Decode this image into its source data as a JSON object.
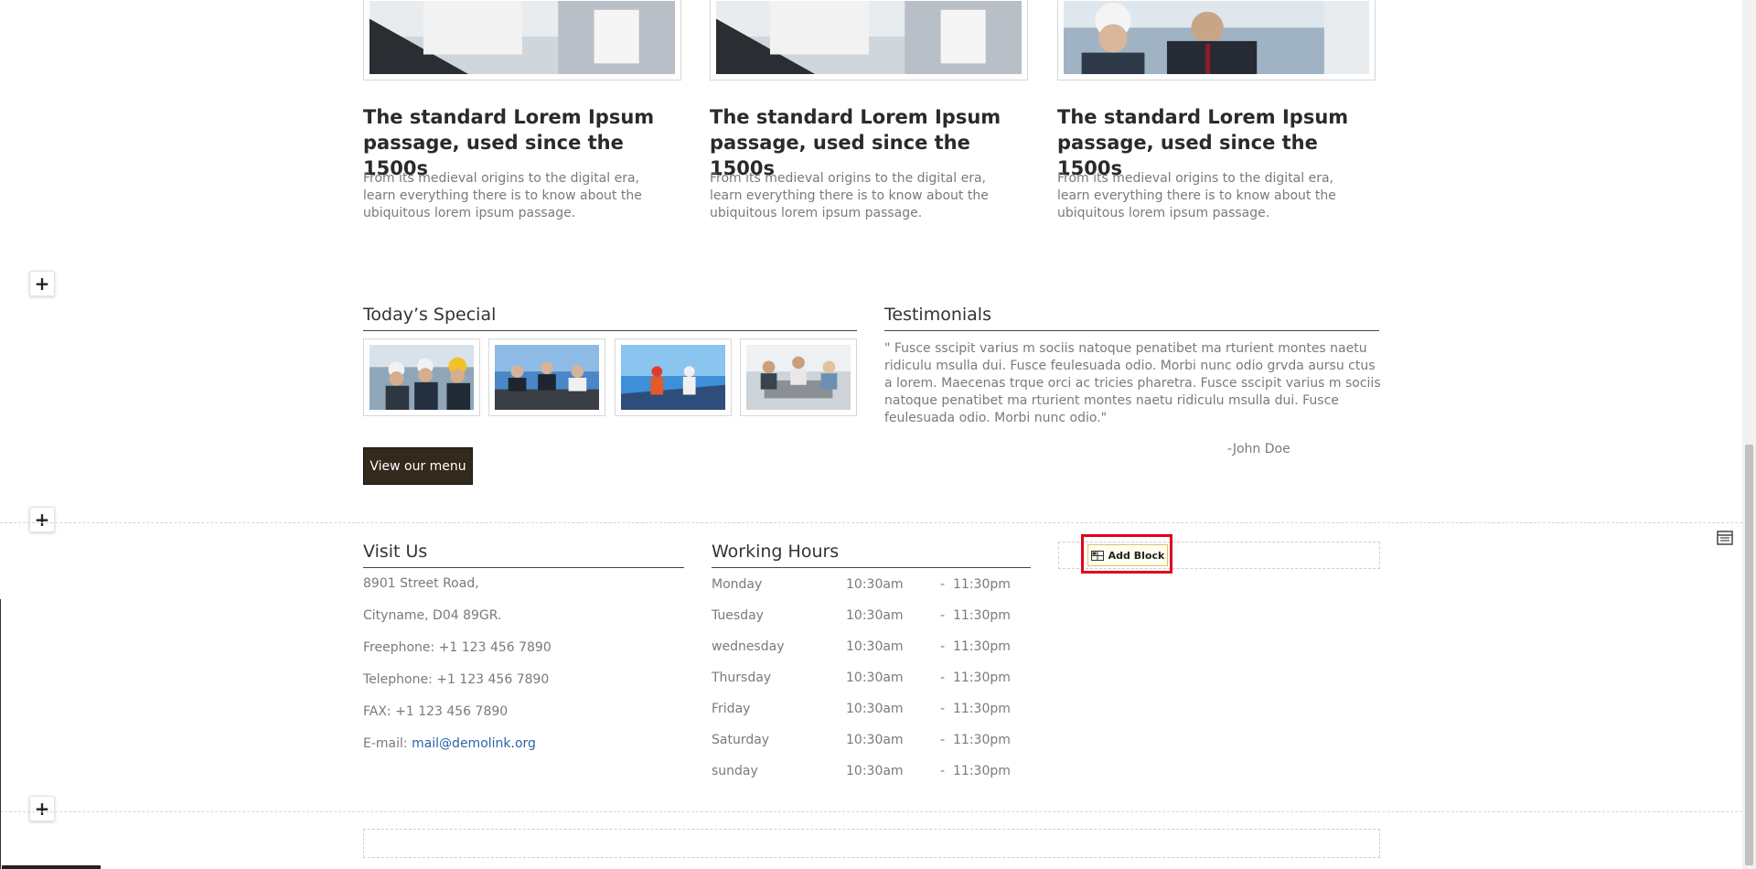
{
  "cards": [
    {
      "title": "The standard Lorem Ipsum passage, used since the 1500s",
      "text": "From its medieval origins to the digital era, learn everything there is to know about the ubiquitous lorem ipsum passage."
    },
    {
      "title": "The standard Lorem Ipsum passage, used since the 1500s",
      "text": "From its medieval origins to the digital era, learn everything there is to know about the ubiquitous lorem ipsum passage."
    },
    {
      "title": "The standard Lorem Ipsum passage, used since the 1500s",
      "text": "From its medieval origins to the digital era, learn everything there is to know about the ubiquitous lorem ipsum passage."
    }
  ],
  "special": {
    "title": "Today’s Special",
    "button_label": "View our menu"
  },
  "testimonials": {
    "title": "Testimonials",
    "quote": "\" Fusce sscipit varius m sociis natoque penatibet ma rturient montes naetu ridiculu msulla dui. Fusce feulesuada odio. Morbi nunc odio grvda aursu ctus a lorem. Maecenas trque orci ac tricies pharetra. Fusce sscipit varius m sociis natoque penatibet ma rturient montes naetu ridiculu msulla dui. Fusce feulesuada odio. Morbi nunc odio.\"",
    "author": "-John Doe"
  },
  "visit": {
    "title": "Visit Us",
    "address1": "8901 Street Road,",
    "address2": "Cityname, D04 89GR.",
    "freephone": "Freephone: +1 123 456 7890",
    "telephone": "Telephone: +1 123 456 7890",
    "fax": "FAX: +1 123 456 7890",
    "email_label": "E-mail: ",
    "email": "mail@demolink.org"
  },
  "hours": {
    "title": "Working Hours",
    "rows": [
      {
        "day": "Monday",
        "open": "10:30am",
        "sep": "-",
        "close": "11:30pm"
      },
      {
        "day": "Tuesday",
        "open": "10:30am",
        "sep": "-",
        "close": "11:30pm"
      },
      {
        "day": "wednesday",
        "open": "10:30am",
        "sep": "-",
        "close": "11:30pm"
      },
      {
        "day": "Thursday",
        "open": "10:30am",
        "sep": "-",
        "close": "11:30pm"
      },
      {
        "day": "Friday",
        "open": "10:30am",
        "sep": "-",
        "close": "11:30pm"
      },
      {
        "day": "Saturday",
        "open": "10:30am",
        "sep": "-",
        "close": "11:30pm"
      },
      {
        "day": "sunday",
        "open": "10:30am",
        "sep": "-",
        "close": "11:30pm"
      }
    ]
  },
  "editor": {
    "add_block_label": "Add Block",
    "plus_label": "+"
  },
  "colors": {
    "highlight": "#e3001b",
    "link": "#2a64a8",
    "menu_button": "#33291c"
  }
}
